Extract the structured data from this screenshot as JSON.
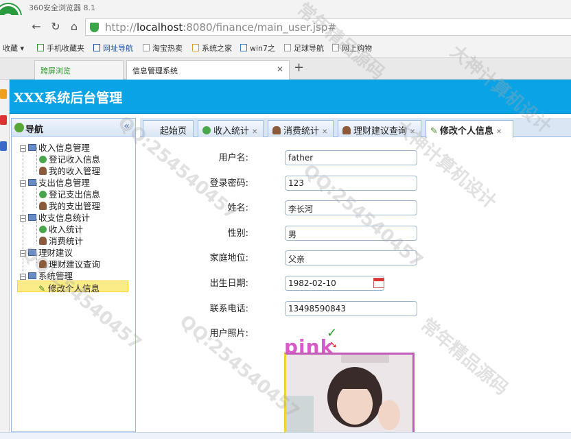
{
  "browser": {
    "title": "360安全浏览器 8.1",
    "url_prefix": "http://",
    "url_host": "localhost",
    "url_rest": ":8080/finance/main_user.jsp#",
    "bookmarks": [
      "收藏",
      "手机收藏夹",
      "网址导航",
      "淘宝热卖",
      "系统之家",
      "win7之",
      "足球导航",
      "网上购物"
    ],
    "tabs": [
      {
        "label": "跨屏浏览"
      },
      {
        "label": "信息管理系统"
      }
    ],
    "new_tab": "+"
  },
  "app": {
    "title": "XXX系统后台管理",
    "nav_title": "导航",
    "collapse": "«",
    "tree": [
      {
        "label": "收入信息管理",
        "level": 0
      },
      {
        "label": "登记收入信息",
        "level": 1
      },
      {
        "label": "我的收入管理",
        "level": 1
      },
      {
        "label": "支出信息管理",
        "level": 0
      },
      {
        "label": "登记支出信息",
        "level": 1
      },
      {
        "label": "我的支出管理",
        "level": 1
      },
      {
        "label": "收支信息统计",
        "level": 0
      },
      {
        "label": "收入统计",
        "level": 1
      },
      {
        "label": "消费统计",
        "level": 1
      },
      {
        "label": "理财建议",
        "level": 0
      },
      {
        "label": "理财建议查询",
        "level": 1
      },
      {
        "label": "系统管理",
        "level": 0
      },
      {
        "label": "修改个人信息",
        "level": 1
      }
    ],
    "tabs": [
      {
        "label": "起始页"
      },
      {
        "label": "收入统计"
      },
      {
        "label": "消费统计"
      },
      {
        "label": "理财建议查询"
      },
      {
        "label": "修改个人信息"
      }
    ],
    "form": {
      "username_label": "用户名:",
      "username": "father",
      "password_label": "登录密码:",
      "password": "123",
      "name_label": "姓名:",
      "name": "李长河",
      "gender_label": "性别:",
      "gender": "男",
      "family_label": "家庭地位:",
      "family": "父亲",
      "birth_label": "出生日期:",
      "birth": "1982-02-10",
      "phone_label": "联系电话:",
      "phone": "13498590843",
      "photo_label": "用户照片:",
      "photo_text": "pink"
    }
  },
  "watermarks": [
    "常年精品源码",
    "QQ:254540457",
    "大神计算机设计"
  ]
}
